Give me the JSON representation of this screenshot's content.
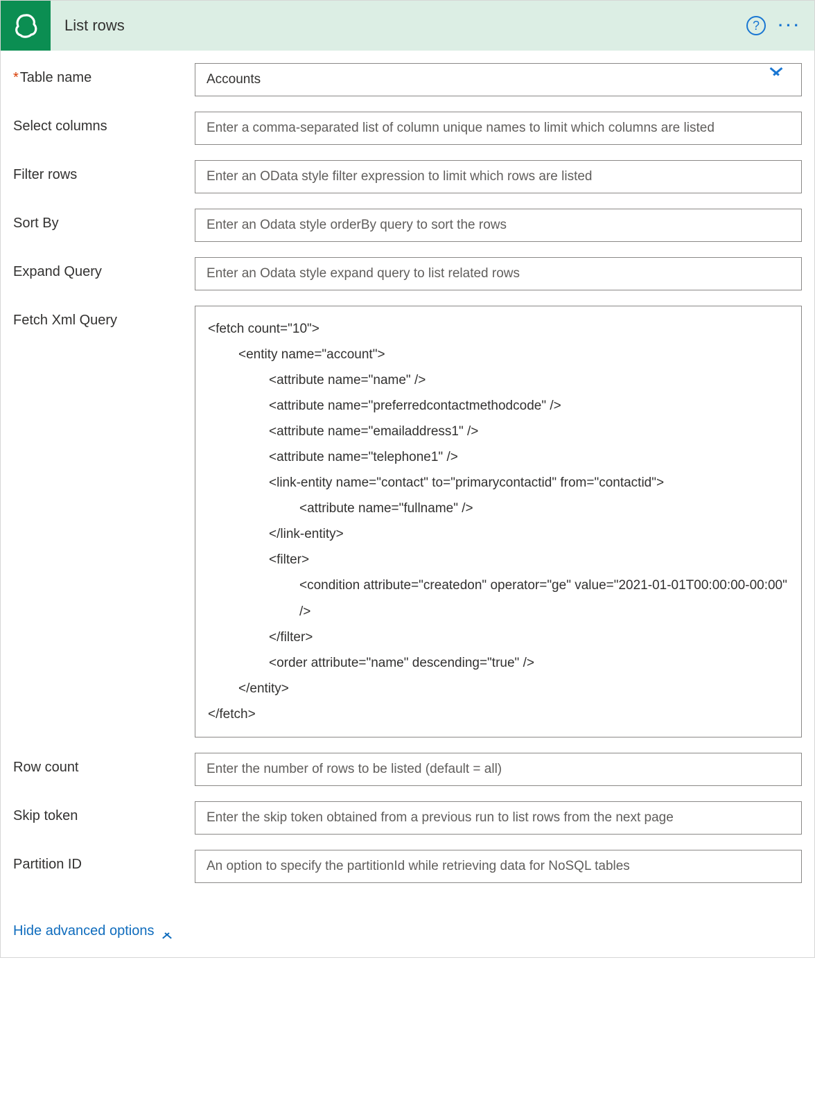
{
  "header": {
    "title": "List rows",
    "help_char": "?",
    "more_char": "···"
  },
  "fields": {
    "tableName": {
      "label": "Table name",
      "value": "Accounts"
    },
    "selectColumns": {
      "label": "Select columns",
      "placeholder": "Enter a comma-separated list of column unique names to limit which columns are listed"
    },
    "filterRows": {
      "label": "Filter rows",
      "placeholder": "Enter an OData style filter expression to limit which rows are listed"
    },
    "sortBy": {
      "label": "Sort By",
      "placeholder": "Enter an Odata style orderBy query to sort the rows"
    },
    "expandQuery": {
      "label": "Expand Query",
      "placeholder": "Enter an Odata style expand query to list related rows"
    },
    "fetchXml": {
      "label": "Fetch Xml Query",
      "lines": [
        {
          "t": "<fetch count=\"10\">",
          "indent": 0
        },
        {
          "t": "<entity name=\"account\">",
          "indent": 1
        },
        {
          "t": "<attribute name=\"name\" />",
          "indent": 2
        },
        {
          "t": "<attribute name=\"preferredcontactmethodcode\" />",
          "indent": 2
        },
        {
          "t": "<attribute name=\"emailaddress1\" />",
          "indent": 2
        },
        {
          "t": "<attribute name=\"telephone1\" />",
          "indent": 2
        },
        {
          "t": "<link-entity name=\"contact\" to=\"primarycontactid\" from=\"contactid\">",
          "indent": 2
        },
        {
          "t": "<attribute name=\"fullname\" />",
          "indent": 3
        },
        {
          "t": "</link-entity>",
          "indent": 2
        },
        {
          "t": "<filter>",
          "indent": 2
        },
        {
          "t": "<condition attribute=\"createdon\" operator=\"ge\" value=\"2021-01-01T00:00:00-00:00\" />",
          "indent": 3
        },
        {
          "t": "</filter>",
          "indent": 2
        },
        {
          "t": "<order attribute=\"name\" descending=\"true\" />",
          "indent": 2
        },
        {
          "t": "</entity>",
          "indent": 1
        },
        {
          "t": "</fetch>",
          "indent": 0
        }
      ]
    },
    "rowCount": {
      "label": "Row count",
      "placeholder": "Enter the number of rows to be listed (default = all)"
    },
    "skipToken": {
      "label": "Skip token",
      "placeholder": "Enter the skip token obtained from a previous run to list rows from the next page"
    },
    "partitionId": {
      "label": "Partition ID",
      "placeholder": "An option to specify the partitionId while retrieving data for NoSQL tables"
    }
  },
  "footer": {
    "toggle_label": "Hide advanced options"
  },
  "colors": {
    "brand": "#0b8e52",
    "accent": "#1976d2"
  }
}
